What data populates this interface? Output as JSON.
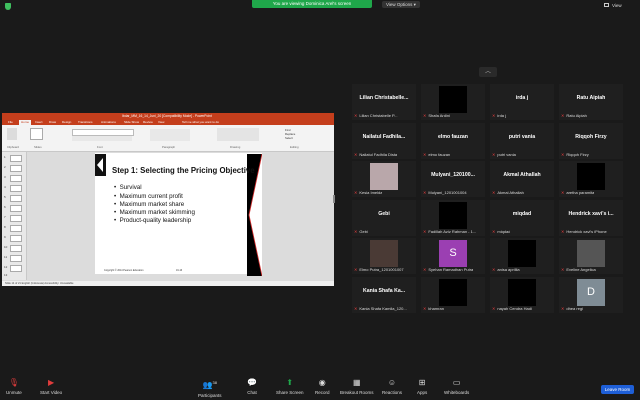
{
  "banner": {
    "viewing": "You are viewing Dominica Arel's screen",
    "view_options": "View Options ▾",
    "view": "View"
  },
  "ppt": {
    "title": "Ibdar_MM_16_14_Juni_20 [Compatibility Mode] - PowerPoint",
    "tabs": [
      "File",
      "Home",
      "Insert",
      "Draw",
      "Design",
      "Transitions",
      "Animations",
      "Slide Show",
      "Review",
      "View",
      "Tell me what you want to do"
    ],
    "ribbon_groups": [
      "Clipboard",
      "Slides",
      "Font",
      "Paragraph",
      "Drawing",
      "Editing"
    ],
    "editing_items": [
      "Find",
      "Replace",
      "Select"
    ],
    "status": "Slide 14 of 21   English (Indonesia)   Accessibility: Unavailable",
    "slide": {
      "title": "Step 1: Selecting the Pricing Objective",
      "bullets": [
        "Survival",
        "Maximum current profit",
        "Maximum market share",
        "Maximum market skimming",
        "Product-quality leadership"
      ],
      "copyright": "Copyright © 2014 Pearson Education",
      "number": "16-16"
    },
    "thumb_numbers": [
      "1",
      "2",
      "3",
      "4",
      "5",
      "6",
      "7",
      "8",
      "9",
      "10",
      "11",
      "12",
      "13"
    ]
  },
  "participants": [
    {
      "name_center": "Lilian  Christabelle...",
      "label": "Lilian Christabelle P...",
      "video": ""
    },
    {
      "name_center": "",
      "label": "Shafa Ardini",
      "video": "#000000"
    },
    {
      "name_center": "irda j",
      "label": "irda j",
      "video": ""
    },
    {
      "name_center": "Ratu Aipiah",
      "label": "Ratu Aipiah",
      "video": ""
    },
    {
      "name_center": "Nailatul  Fadhila...",
      "label": "Nailatul Fadhila Dista",
      "video": ""
    },
    {
      "name_center": "elmo fauzan",
      "label": "elmo fauzan",
      "video": ""
    },
    {
      "name_center": "putri vania",
      "label": "putri vania",
      "video": ""
    },
    {
      "name_center": "Riqqoh Firzy",
      "label": "Riqqoh Firzy",
      "video": ""
    },
    {
      "name_center": "",
      "label": "Kesia Imelda",
      "video": "#b9a7aa"
    },
    {
      "name_center": "Mulyani_120100...",
      "label": "Mulyani_1201001004",
      "video": ""
    },
    {
      "name_center": "Akmal Athallah",
      "label": "Akmal Athallah",
      "video": ""
    },
    {
      "name_center": "",
      "label": "aretha paramita",
      "video": "#000000"
    },
    {
      "name_center": "Gebi",
      "label": "Gebi",
      "video": ""
    },
    {
      "name_center": "",
      "label": "Fadillah Aziz Rahman - 1...",
      "video": "#000000"
    },
    {
      "name_center": "miqdad",
      "label": "miqdad",
      "video": ""
    },
    {
      "name_center": "Hendrick xavi's i...",
      "label": "Hendrick xavi's iPhone",
      "video": ""
    },
    {
      "name_center": "",
      "label": "Elmo Putra_1201001007",
      "video": "#4a3a35"
    },
    {
      "name_center": "",
      "label": "Syehan Ramadhan Putra",
      "video": "#9b3fb2",
      "avatar": "S"
    },
    {
      "name_center": "",
      "label": "anisa aprillia",
      "video": "#000000"
    },
    {
      "name_center": "",
      "label": "Eveline Angelica",
      "video": "#555555"
    },
    {
      "name_center": "Kania  Shafa  Ka...",
      "label": "Kania Shafa Kamila_120...",
      "video": ""
    },
    {
      "name_center": "",
      "label": "khamran",
      "video": "#000000"
    },
    {
      "name_center": "",
      "label": "nayah Cendra Hadi",
      "video": "#000000"
    },
    {
      "name_center": "",
      "label": "dhea regi",
      "video": "#7f8c95",
      "avatar": "D"
    }
  ],
  "toolbar": {
    "unmute": "Unmute",
    "start_video": "Start Video",
    "participants": "Participants",
    "participants_count": "38",
    "chat": "Chat",
    "share": "Share Screen",
    "record": "Record",
    "breakout": "Breakout Rooms",
    "reactions": "Reactions",
    "apps": "Apps",
    "whiteboards": "Whiteboards",
    "leave": "Leave Room"
  },
  "colors": {
    "accent_green": "#1fa74a",
    "ppt_orange": "#c43e1c",
    "leave_blue": "#1e5fd8",
    "muted_red": "#e03c3c"
  }
}
